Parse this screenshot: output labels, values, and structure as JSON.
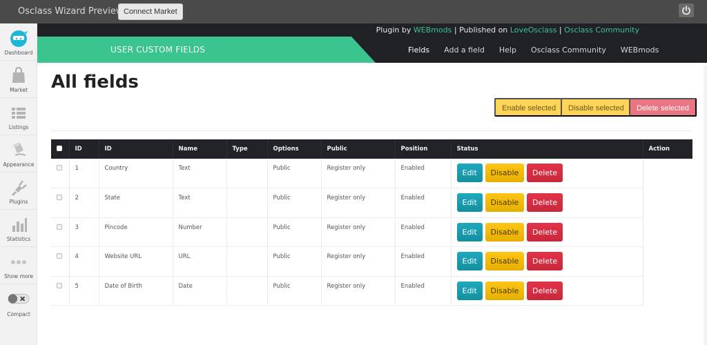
{
  "topbar": {
    "title": "Osclass Wizard Preview",
    "connect_label": "Connect Market",
    "power_icon": "power-icon"
  },
  "sidebar": {
    "items": [
      {
        "label": "Dashboard",
        "icon": "ninja-logo-icon"
      },
      {
        "label": "Market",
        "icon": "shopping-bag-icon"
      },
      {
        "label": "Listings",
        "icon": "list-icon"
      },
      {
        "label": "Appearance",
        "icon": "paint-bucket-icon"
      },
      {
        "label": "Plugins",
        "icon": "plug-icon"
      },
      {
        "label": "Statistics",
        "icon": "bar-chart-icon"
      },
      {
        "label": "Show more",
        "icon": "more-dots-icon"
      },
      {
        "label": "Compact",
        "icon": "toggle-icon"
      }
    ]
  },
  "header": {
    "credits": {
      "plugin_by": "Plugin by",
      "author": "WEBmods",
      "sep1": "|",
      "published_on": "Published on",
      "site": "LoveOsclass",
      "sep2": "|",
      "community": "Osclass Community"
    },
    "banner": "USER CUSTOM FIELDS",
    "nav": [
      "Fields",
      "Add a field",
      "Help",
      "Osclass Community",
      "WEBmods"
    ],
    "active_nav": "Fields"
  },
  "main": {
    "title": "All fields",
    "bulk_actions": {
      "enable": "Enable selected",
      "disable": "Disable selected",
      "delete": "Delete selected"
    },
    "colors": {
      "accent": "#3cc48f",
      "edit": "#1ea9bd",
      "disable": "#ffc617",
      "delete": "#e23348"
    },
    "table": {
      "columns": [
        "",
        "ID",
        "ID",
        "Name",
        "Type",
        "Options",
        "Public",
        "Position",
        "Status",
        "Action"
      ],
      "rows": [
        {
          "id": "1",
          "name": "Country",
          "type": "Text",
          "options": "",
          "public": "Public",
          "position": "Register only",
          "status": "Enabled"
        },
        {
          "id": "2",
          "name": "State",
          "type": "Text",
          "options": "",
          "public": "Public",
          "position": "Register only",
          "status": "Enabled"
        },
        {
          "id": "3",
          "name": "Pincode",
          "type": "Number",
          "options": "",
          "public": "Public",
          "position": "Register only",
          "status": "Enabled"
        },
        {
          "id": "4",
          "name": "Website URL",
          "type": "URL",
          "options": "",
          "public": "Public",
          "position": "Register only",
          "status": "Enabled"
        },
        {
          "id": "5",
          "name": "Date of Birth",
          "type": "Date",
          "options": "",
          "public": "Public",
          "position": "Register only",
          "status": "Enabled"
        }
      ],
      "row_actions": {
        "edit": "Edit",
        "disable": "Disable",
        "delete": "Delete"
      }
    }
  }
}
